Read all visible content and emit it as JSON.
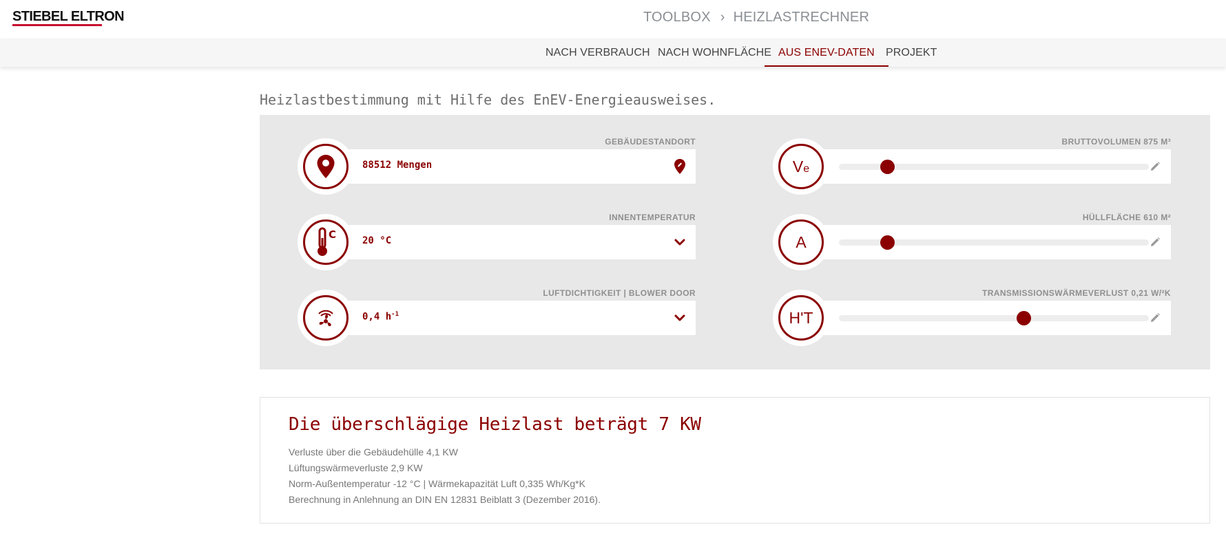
{
  "header": {
    "logo_text": "STIEBEL ELTRON",
    "breadcrumb": [
      "TOOLBOX",
      "HEIZLASTRECHNER"
    ],
    "breadcrumb_separator": "›"
  },
  "tabs": [
    {
      "label": "NACH VERBRAUCH",
      "active": false
    },
    {
      "label": "NACH WOHNFLÄCHE",
      "active": false
    },
    {
      "label": "AUS ENEV-DATEN",
      "active": true
    },
    {
      "label": "PROJEKT",
      "active": false
    }
  ],
  "intro_text": "Heizlastbestimmung mit Hilfe des EnEV-Energieausweises.",
  "left_fields": [
    {
      "label": "GEBÄUDESTANDORT",
      "value": "88512 Mengen",
      "icon": "location-pin-icon",
      "action_icon": "location-edit-icon"
    },
    {
      "label": "INNENTEMPERATUR",
      "value": "20 °C",
      "icon": "thermometer-icon",
      "action_icon": "chevron-down-icon"
    },
    {
      "label": "LUFTDICHTIGKEIT | BLOWER DOOR",
      "value": "0,4 h",
      "value_sup": "-1",
      "icon": "fan-icon",
      "action_icon": "chevron-down-icon"
    }
  ],
  "right_fields": [
    {
      "label": "BRUTTOVOLUMEN 875 m³",
      "symbol_main": "V",
      "symbol_sub": "e",
      "slider_fraction": 0.155,
      "action_icon": "pencil-icon"
    },
    {
      "label": "HÜLLFLÄCHE 610 m²",
      "symbol_main": "A",
      "symbol_sub": "",
      "slider_fraction": 0.155,
      "action_icon": "pencil-icon"
    },
    {
      "label": "TRANSMISSIONSWÄRMEVERLUST 0,21 W/²K",
      "symbol_main": "H'T",
      "symbol_sub": "",
      "slider_fraction": 0.595,
      "action_icon": "pencil-icon"
    }
  ],
  "result": {
    "title": "Die überschlägige Heizlast beträgt 7 KW",
    "lines": [
      "Verluste über die Gebäudehülle 4,1 KW",
      "Lüftungswärmeverluste 2,9 KW",
      "Norm-Außentemperatur -12 °C | Wärmekapazität Luft 0,335 Wh/Kg*K",
      "Berechnung in Anlehnung an DIN EN 12831 Beiblatt 3 (Dezember 2016)."
    ]
  },
  "colors": {
    "accent": "#8b0000",
    "brand_red": "#c8102e",
    "panel_bg": "#e8e8e8",
    "label_gray": "#8f8f8f"
  }
}
